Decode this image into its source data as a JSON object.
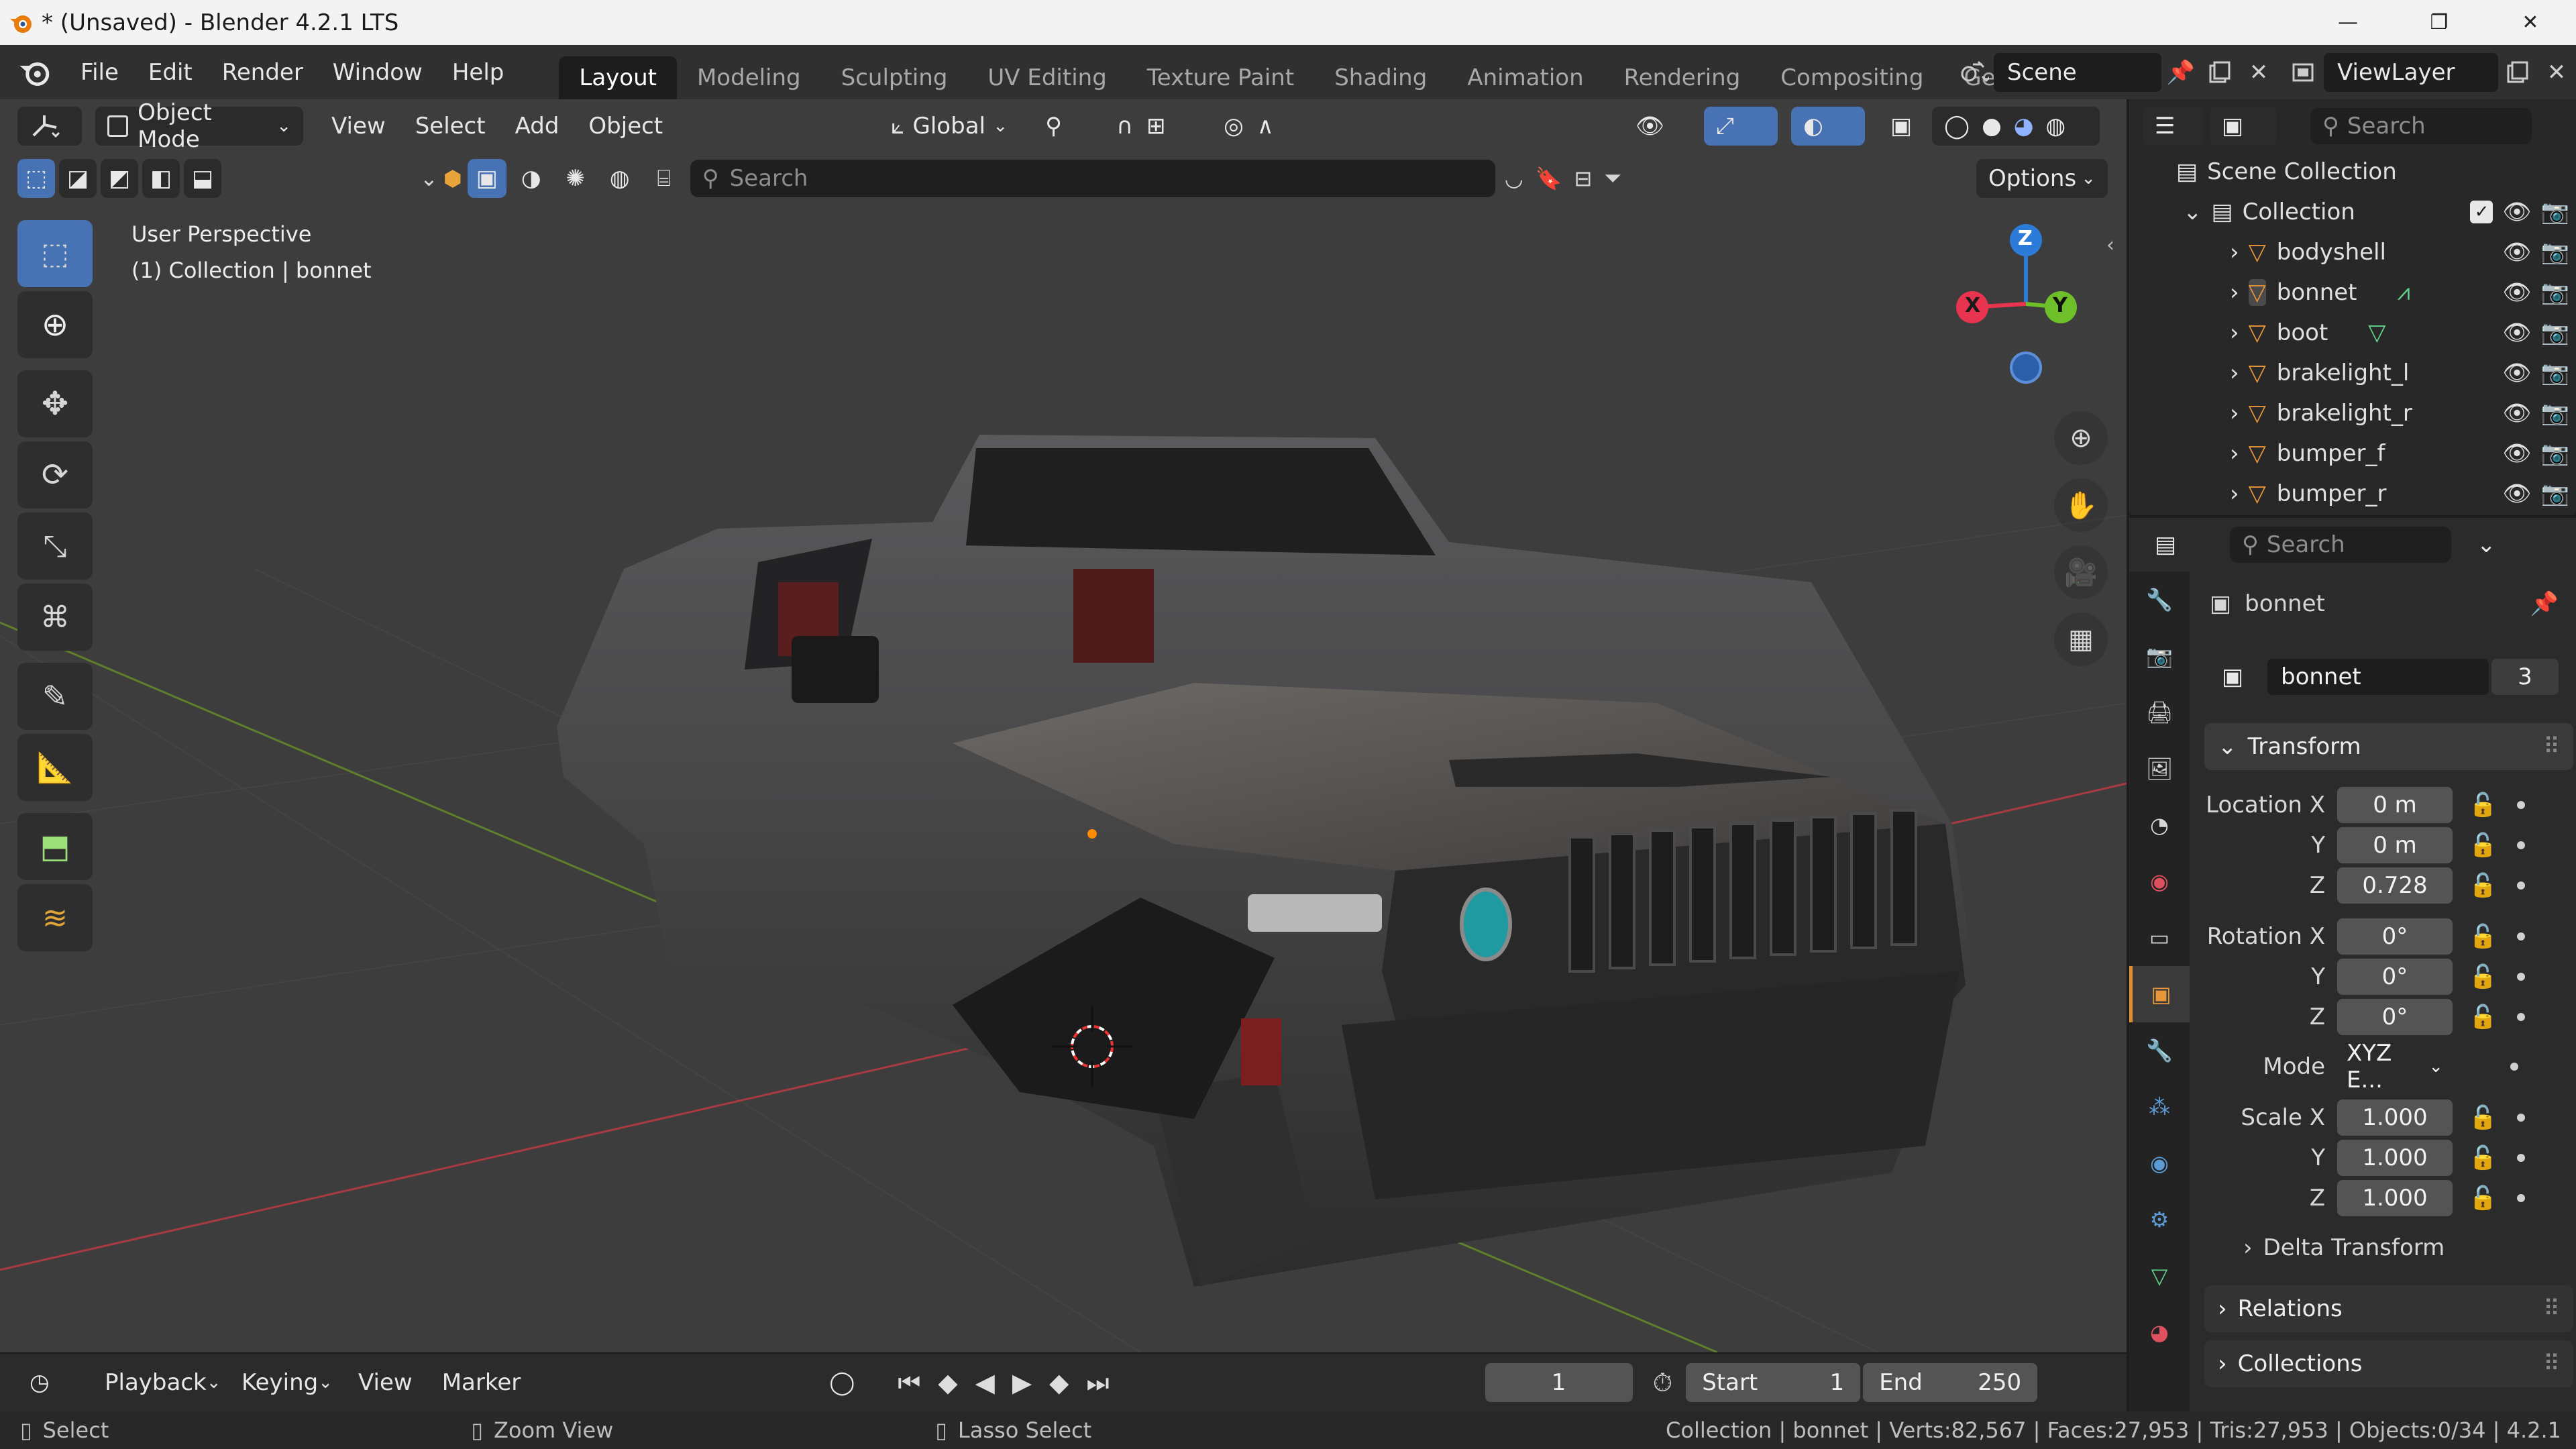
{
  "window": {
    "title": "* (Unsaved) - Blender 4.2.1 LTS",
    "minimize": "—",
    "maximize": "❐",
    "close": "✕"
  },
  "menu": [
    "File",
    "Edit",
    "Render",
    "Window",
    "Help"
  ],
  "workspaces": [
    "Layout",
    "Modeling",
    "Sculpting",
    "UV Editing",
    "Texture Paint",
    "Shading",
    "Animation",
    "Rendering",
    "Compositing",
    "Geometry N"
  ],
  "active_workspace": "Layout",
  "scene": {
    "name": "Scene",
    "view_layer": "ViewLayer"
  },
  "viewport": {
    "mode": "Object Mode",
    "menus": [
      "View",
      "Select",
      "Add",
      "Object"
    ],
    "transform_orientation": "Global",
    "search_placeholder": "Search",
    "options_label": "Options",
    "perspective_label": "User Perspective",
    "collection_label": "(1) Collection | bonnet",
    "gizmo": {
      "z": "Z",
      "x": "X",
      "y": "Y"
    }
  },
  "timeline": {
    "menus": [
      "Playback",
      "Keying",
      "View",
      "Marker"
    ],
    "current_frame": "1",
    "start_label": "Start",
    "start": "1",
    "end_label": "End",
    "end": "250"
  },
  "statusbar": {
    "select": "Select",
    "zoom": "Zoom View",
    "lasso": "Lasso Select",
    "stats": "Collection | bonnet | Verts:82,567 | Faces:27,953 | Tris:27,953 | Objects:0/34 | 4.2.1"
  },
  "outliner": {
    "search_placeholder": "Search",
    "scene_collection": "Scene Collection",
    "collection": "Collection",
    "items": [
      {
        "name": "bodyshell"
      },
      {
        "name": "bonnet"
      },
      {
        "name": "boot"
      },
      {
        "name": "brakelight_l"
      },
      {
        "name": "brakelight_r"
      },
      {
        "name": "bumper_f"
      },
      {
        "name": "bumper_r"
      }
    ]
  },
  "properties": {
    "search_placeholder": "Search",
    "object_name": "bonnet",
    "data_name": "bonnet",
    "users": "3",
    "transform": {
      "title": "Transform",
      "location_label": "Location X",
      "location": [
        "0 m",
        "0 m",
        "0.728"
      ],
      "rotation_label": "Rotation X",
      "rotation": [
        "0°",
        "0°",
        "0°"
      ],
      "mode_label": "Mode",
      "mode": "XYZ E...",
      "scale_label": "Scale X",
      "scale": [
        "1.000",
        "1.000",
        "1.000"
      ],
      "y": "Y",
      "z": "Z"
    },
    "delta": "Delta Transform",
    "relations": "Relations",
    "collections": "Collections"
  },
  "colors": {
    "accent_blue": "#4772b3",
    "active_orange": "#e08e30",
    "axis_x": "#e8344e",
    "axis_y": "#6fbf2a",
    "axis_z": "#2c7bd8"
  }
}
